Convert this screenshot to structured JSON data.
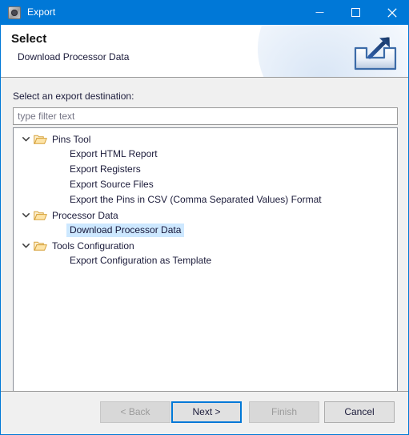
{
  "window": {
    "title": "Export",
    "icon": "export-app-icon",
    "controls": [
      {
        "name": "minimize-button",
        "glyph": "minimize-icon"
      },
      {
        "name": "maximize-button",
        "glyph": "maximize-icon"
      },
      {
        "name": "close-button",
        "glyph": "close-icon"
      }
    ],
    "titlebar_color": "#0078d7"
  },
  "header": {
    "title": "Select",
    "subtitle": "Download Processor Data",
    "icon": "export-arrow-tray-icon"
  },
  "body": {
    "destination_label": "Select an export destination:",
    "filter": {
      "value": "",
      "placeholder": "type filter text"
    },
    "tree": {
      "selection_color": "#cde8ff",
      "groups": [
        {
          "label": "Pins Tool",
          "expanded": true,
          "icon": "open-folder-icon",
          "children": [
            {
              "label": "Export HTML Report",
              "selected": false
            },
            {
              "label": "Export Registers",
              "selected": false
            },
            {
              "label": "Export Source Files",
              "selected": false
            },
            {
              "label": "Export the Pins in CSV (Comma Separated Values) Format",
              "selected": false
            }
          ]
        },
        {
          "label": "Processor Data",
          "expanded": true,
          "icon": "open-folder-icon",
          "children": [
            {
              "label": "Download Processor Data",
              "selected": true
            }
          ]
        },
        {
          "label": "Tools Configuration",
          "expanded": true,
          "icon": "open-folder-icon",
          "children": [
            {
              "label": "Export Configuration as Template",
              "selected": false
            }
          ]
        }
      ]
    }
  },
  "footer": {
    "buttons": [
      {
        "name": "back-button",
        "label": "< Back",
        "enabled": false,
        "focused": false
      },
      {
        "name": "next-button",
        "label": "Next >",
        "enabled": true,
        "focused": true
      },
      {
        "name": "finish-button",
        "label": "Finish",
        "enabled": false,
        "focused": false
      },
      {
        "name": "cancel-button",
        "label": "Cancel",
        "enabled": true,
        "focused": false
      }
    ],
    "focus_color": "#0078d7"
  }
}
